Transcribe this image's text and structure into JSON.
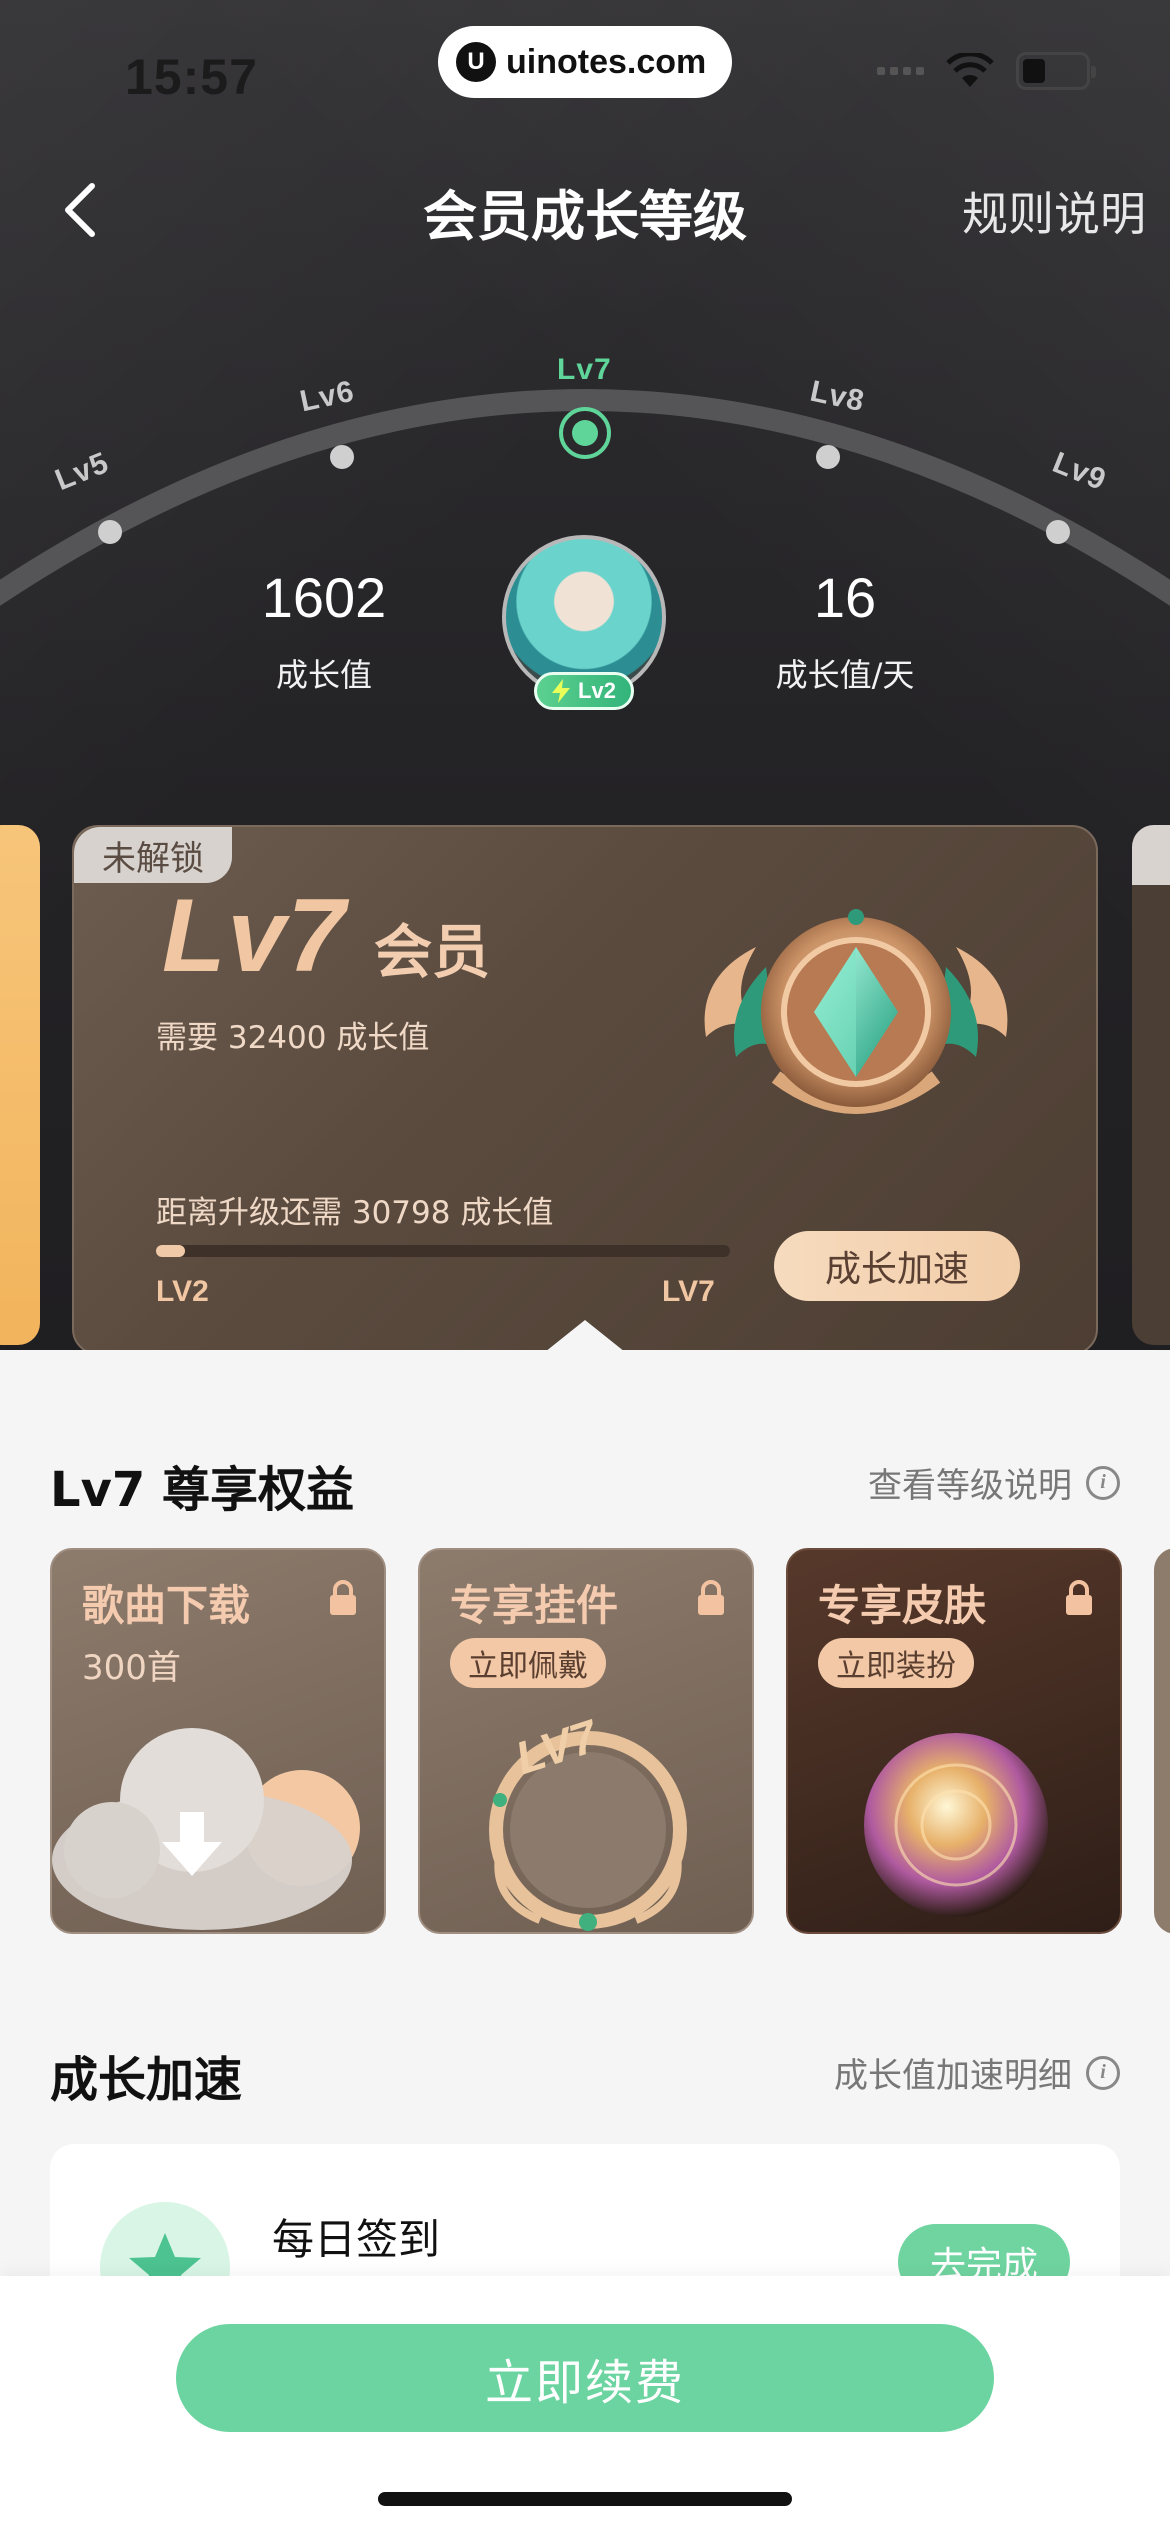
{
  "status_bar": {
    "time": "15:57",
    "url": "uinotes.com"
  },
  "nav": {
    "title": "会员成长等级",
    "rules": "规则说明"
  },
  "levels": {
    "items": [
      "Lv5",
      "Lv6",
      "Lv7",
      "Lv8",
      "Lv9"
    ],
    "current": "Lv7"
  },
  "stats": {
    "growth_value": "1602",
    "growth_value_label": "成长值",
    "daily_value": "16",
    "daily_value_label": "成长值/天"
  },
  "avatar": {
    "badge": "Lv2"
  },
  "level_card": {
    "lock_tag": "未解锁",
    "level": "Lv7",
    "member": "会员",
    "need": "需要  32400  成长值",
    "remain": "距离升级还需  30798  成长值",
    "progress_percent": 5,
    "from": "LV2",
    "to": "LV7",
    "boost_button": "成长加速"
  },
  "benefits": {
    "title": "Lv7 尊享权益",
    "link": "查看等级说明",
    "items": [
      {
        "title": "歌曲下载",
        "sub": "300首"
      },
      {
        "title": "专享挂件",
        "action": "立即佩戴"
      },
      {
        "title": "专享皮肤",
        "action": "立即装扮"
      }
    ]
  },
  "boost": {
    "title": "成长加速",
    "link": "成长值加速明细",
    "tasks": [
      {
        "name": "每日签到",
        "action": "去完成"
      }
    ]
  },
  "bottom": {
    "renew_button": "立即续费"
  },
  "colors": {
    "accent_green": "#6bd4a0",
    "gold": "#f1c6a2",
    "dark_bg": "#2a292c"
  },
  "icons": [
    "back-arrow-icon",
    "info-icon",
    "lock-icon",
    "download-icon",
    "star-icon",
    "lightning-icon"
  ]
}
